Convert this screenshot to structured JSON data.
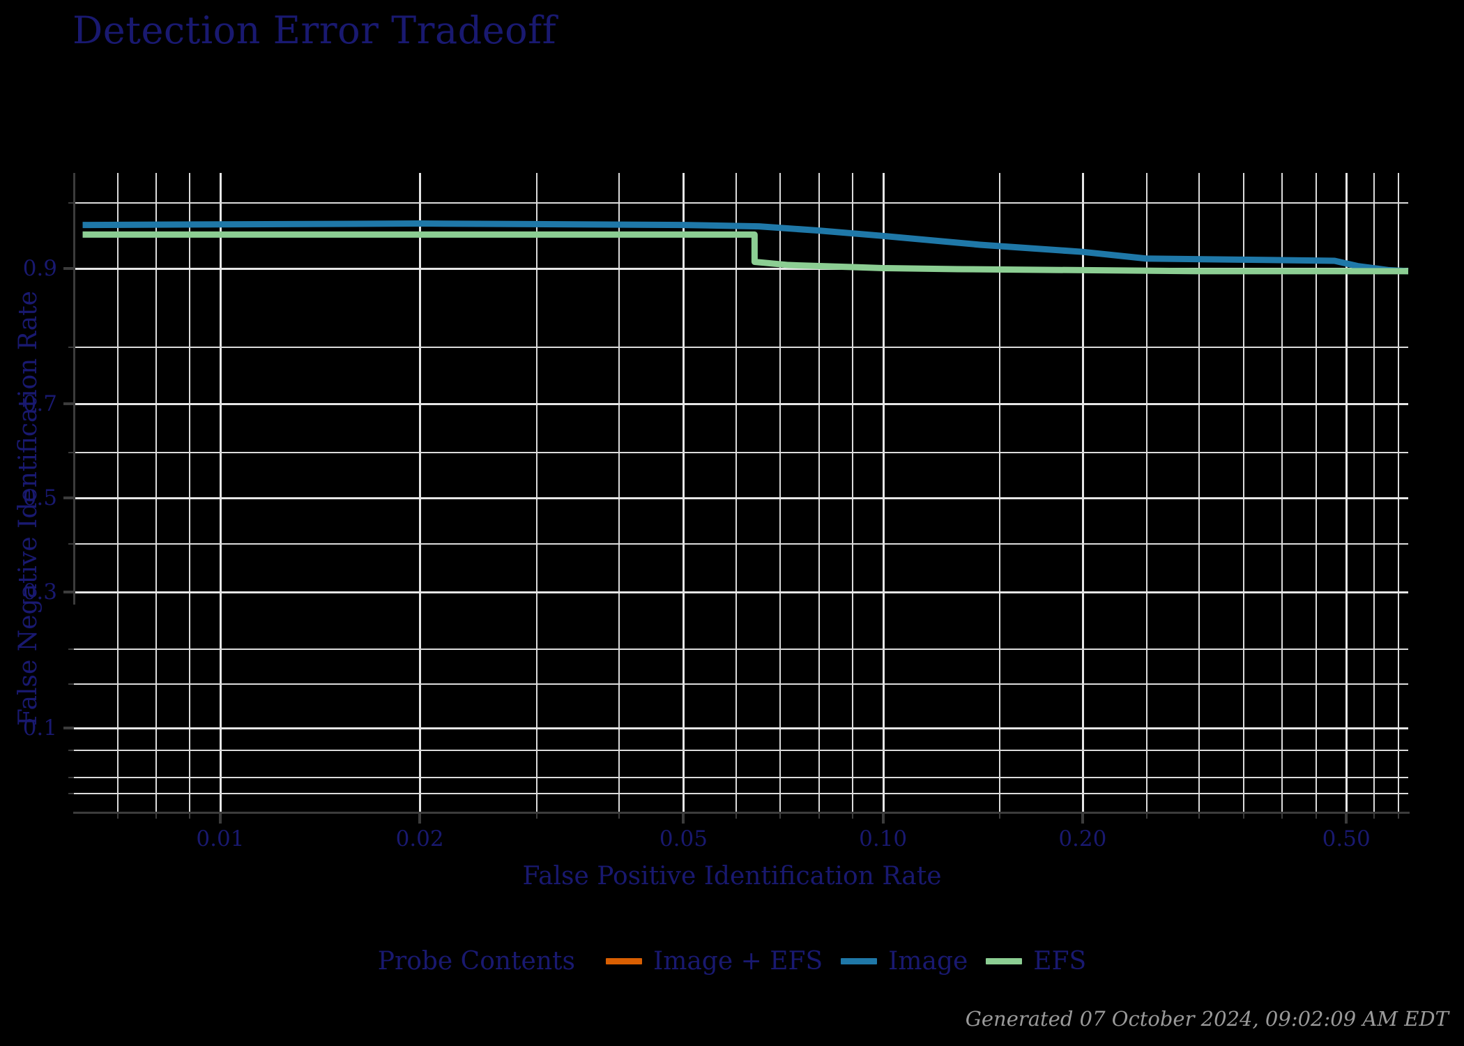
{
  "title": "Detection Error Tradeoff",
  "axes": {
    "xlabel": "False Positive Identification Rate",
    "ylabel": "False Negative Identification Rate",
    "xticks": [
      "0.01",
      "0.02",
      "0.05",
      "0.10",
      "0.20",
      "0.50"
    ],
    "yticks": [
      "0.9",
      "0.7",
      "0.5",
      "0.3",
      "0.1"
    ]
  },
  "legend": {
    "title": "Probe Contents",
    "entries": [
      {
        "label": "Image + EFS",
        "color": "#d95f02"
      },
      {
        "label": "Image",
        "color": "#1f78a8"
      },
      {
        "label": "EFS",
        "color": "#8cce93"
      }
    ]
  },
  "footer": "Generated 07 October 2024, 09:02:09 AM EDT",
  "colors": {
    "background": "#000000",
    "text": "#191970",
    "grid": "#e6e6e6",
    "spine": "#3c3c3c",
    "footer_text": "#9a9a9a"
  },
  "chart_data": {
    "type": "line",
    "title": "Detection Error Tradeoff",
    "xlabel": "False Positive Identification Rate",
    "ylabel": "False Negative Identification Rate",
    "xscale": "log-normal-deviate",
    "yscale": "normal-deviate",
    "xlim": [
      0.006,
      0.62
    ],
    "ylim": [
      0.04,
      0.965
    ],
    "xticks": [
      0.01,
      0.02,
      0.05,
      0.1,
      0.2,
      0.5
    ],
    "yticks": [
      0.9,
      0.7,
      0.5,
      0.3,
      0.1
    ],
    "grid": true,
    "legend_position": "bottom",
    "series": [
      {
        "name": "Image + EFS",
        "color": "#d95f02",
        "points": []
      },
      {
        "name": "Image",
        "color": "#1f78a8",
        "points": [
          [
            0.0062,
            0.936
          ],
          [
            0.02,
            0.937
          ],
          [
            0.05,
            0.936
          ],
          [
            0.065,
            0.935
          ],
          [
            0.08,
            0.932
          ],
          [
            0.1,
            0.928
          ],
          [
            0.14,
            0.921
          ],
          [
            0.2,
            0.915
          ],
          [
            0.25,
            0.909
          ],
          [
            0.35,
            0.908
          ],
          [
            0.48,
            0.907
          ],
          [
            0.52,
            0.902
          ],
          [
            0.58,
            0.898
          ],
          [
            0.62,
            0.897
          ]
        ]
      },
      {
        "name": "EFS",
        "color": "#8cce93",
        "points": [
          [
            0.0062,
            0.929
          ],
          [
            0.02,
            0.929
          ],
          [
            0.05,
            0.929
          ],
          [
            0.064,
            0.929
          ],
          [
            0.064,
            0.906
          ],
          [
            0.072,
            0.903
          ],
          [
            0.09,
            0.901
          ],
          [
            0.1,
            0.9
          ],
          [
            0.13,
            0.899
          ],
          [
            0.2,
            0.898
          ],
          [
            0.3,
            0.897
          ],
          [
            0.45,
            0.897
          ],
          [
            0.62,
            0.897
          ]
        ]
      }
    ]
  }
}
